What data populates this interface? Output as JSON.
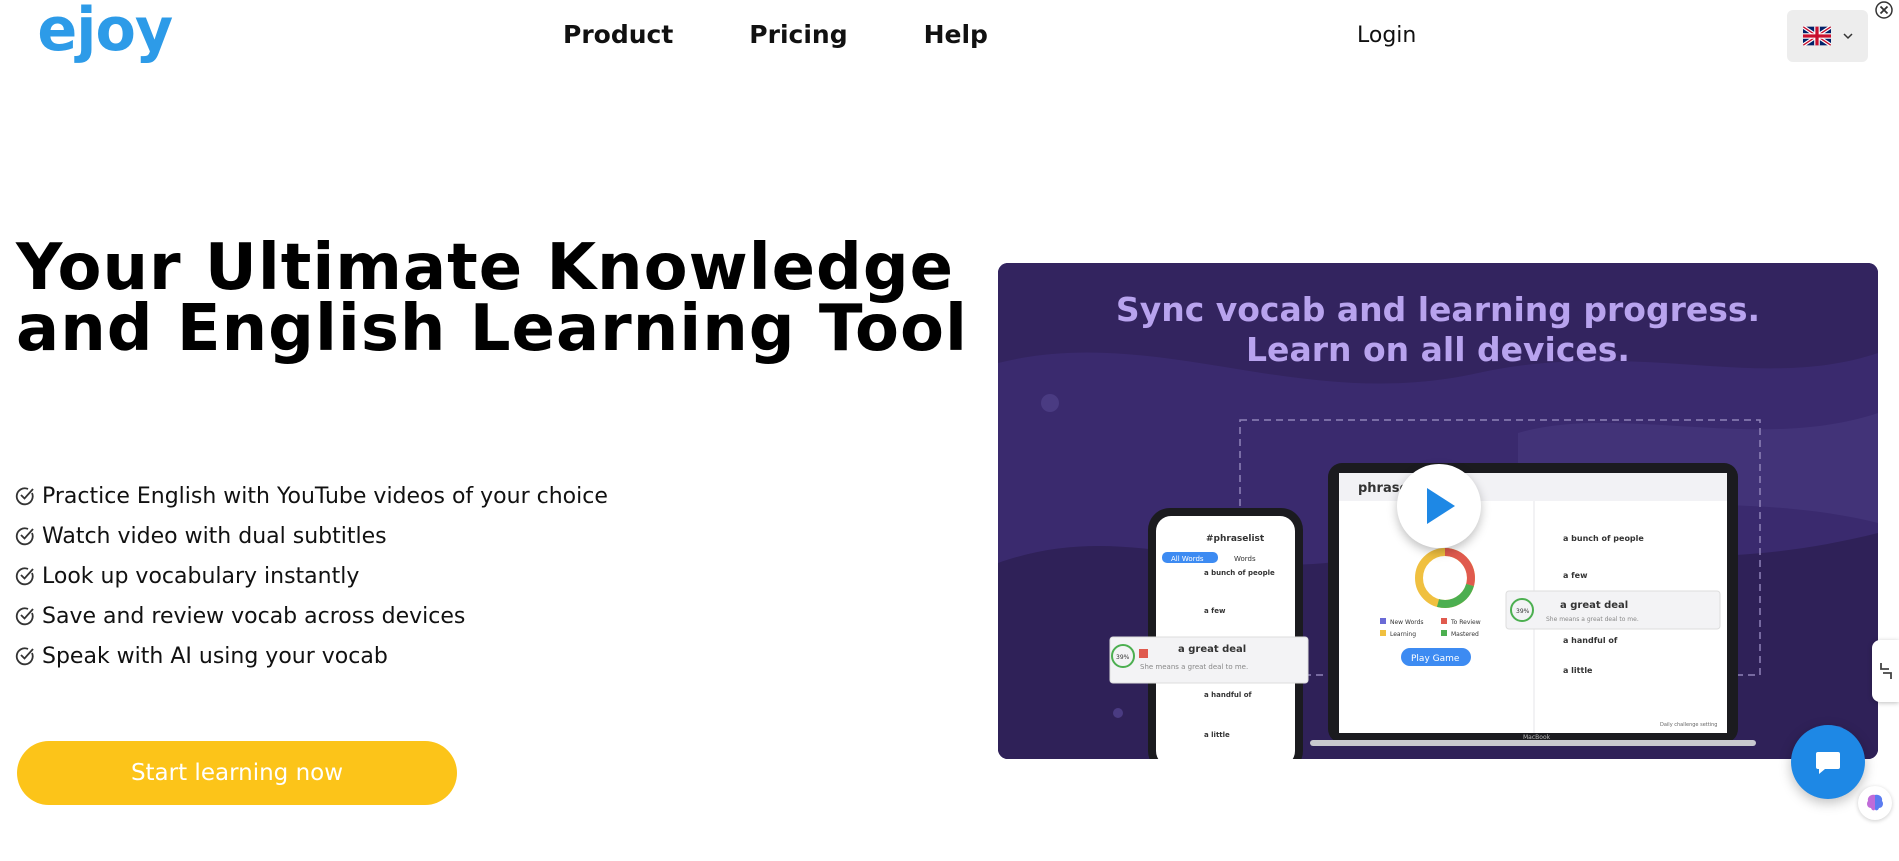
{
  "header": {
    "logo_text": "ejoy",
    "nav": [
      "Product",
      "Pricing",
      "Help"
    ],
    "login_label": "Login",
    "language": {
      "icon": "uk-flag-icon",
      "selected": "English"
    }
  },
  "hero": {
    "title_line1": "Your Ultimate Knowledge",
    "title_line2": "and English Learning Tool",
    "features": [
      "Practice English with YouTube videos of your choice",
      "Watch video with dual subtitles",
      "Look up vocabulary instantly",
      "Save and review vocab across devices",
      "Speak with AI using your vocab"
    ],
    "cta_label": "Start learning now"
  },
  "video": {
    "headline_line1": "Sync vocab and learning progress.",
    "headline_line2": "Learn on all devices.",
    "phone": {
      "title": "#phraselist",
      "tabs": [
        "All Words",
        "Words"
      ],
      "items": [
        "a bunch of people",
        "a few",
        "a handful of",
        "a little"
      ],
      "card_phrase": "a great deal",
      "card_example": "She means a great deal to me.",
      "card_percent": "39%"
    },
    "laptop": {
      "title": "phraseli",
      "items": [
        "a bunch of people",
        "a few",
        "a handful of",
        "a little"
      ],
      "card_phrase": "a great deal",
      "card_example": "She means a great deal to me.",
      "card_percent": "39%",
      "play_game_label": "Play Game",
      "legend": [
        "New Words",
        "Learning",
        "To Review",
        "Mastered"
      ],
      "brand": "MacBook",
      "footer_note": "Daily challenge setting"
    }
  },
  "colors": {
    "brand_blue": "#2d9be8",
    "cta_yellow": "#fcc419",
    "video_bg": "#3a2a6e",
    "headline_purple": "#b8a3ee",
    "chat_blue": "#1e88e5"
  },
  "icons": {
    "feature_check": "check-circle-icon",
    "play": "play-icon",
    "chat": "chat-bubble-icon",
    "close": "close-icon",
    "chevron": "chevron-down-icon",
    "side_tab": "collapse-icon",
    "brain": "brain-icon"
  }
}
